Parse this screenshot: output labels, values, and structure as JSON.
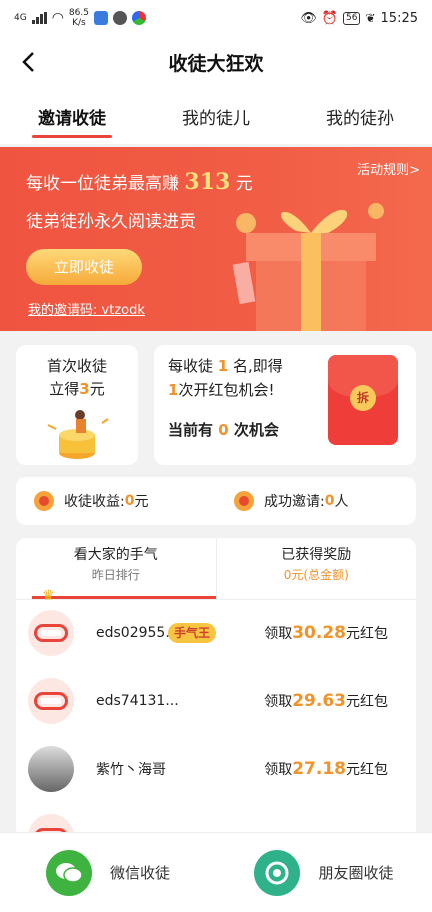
{
  "status_bar": {
    "network": "4G",
    "speed_value": "86.5",
    "speed_unit": "K/s",
    "battery": "56",
    "time": "15:25"
  },
  "header": {
    "title": "收徒大狂欢"
  },
  "tabs": [
    {
      "label": "邀请收徒"
    },
    {
      "label": "我的徒儿"
    },
    {
      "label": "我的徒孙"
    }
  ],
  "banner": {
    "rules_link": "活动规则>",
    "line1_prefix": "每收一位徒弟最高赚",
    "line1_amount": "313",
    "line1_suffix": "元",
    "line2": "徒弟徒孙永久阅读进贡",
    "invite_button": "立即收徒",
    "invite_code_label": "我的邀请码:",
    "invite_code_value": "vtzodk"
  },
  "first_card": {
    "line1": "首次收徒",
    "line2_prefix": "立得",
    "line2_amount": "3",
    "line2_suffix": "元"
  },
  "redpack_card": {
    "line1_prefix": "每收徒",
    "line1_count": "1",
    "line1_suffix": "名,即得",
    "line2_count": "1",
    "line2_suffix": "次开红包机会!",
    "line3_prefix": "当前有",
    "line3_count": "0",
    "line3_suffix": "次机会",
    "open_glyph": "拆"
  },
  "stats": {
    "income_label": "收徒收益:",
    "income_value": "0",
    "income_unit": "元",
    "invites_label": "成功邀请:",
    "invites_value": "0",
    "invites_unit": "人"
  },
  "ranking": {
    "left_title": "看大家的手气",
    "left_sub": "昨日排行",
    "right_title": "已获得奖励",
    "right_sub": "0元(总金额)",
    "rows": [
      {
        "name": "eds02955...",
        "badge": "手气王",
        "prefix": "领取",
        "amount": "30.28",
        "suffix": "元红包"
      },
      {
        "name": "eds74131...",
        "prefix": "领取",
        "amount": "29.63",
        "suffix": "元红包"
      },
      {
        "name": "紫竹丶海哥",
        "prefix": "领取",
        "amount": "27.18",
        "suffix": "元红包"
      }
    ]
  },
  "bottom": {
    "wechat_label": "微信收徒",
    "moments_label": "朋友圈收徒"
  }
}
